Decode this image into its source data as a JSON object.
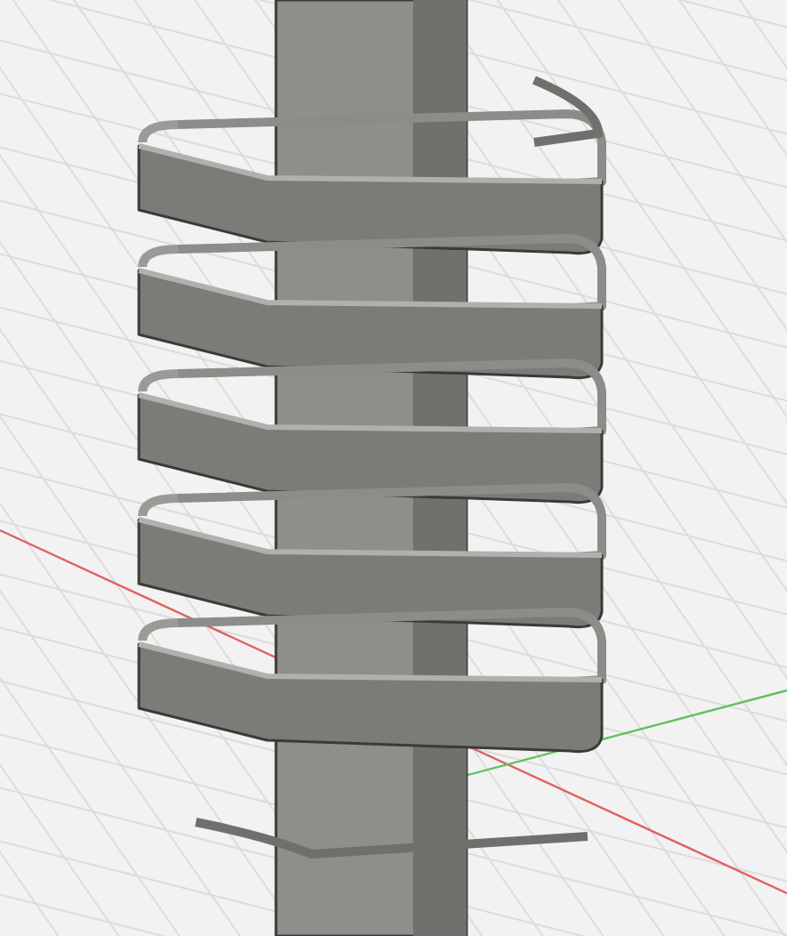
{
  "viewport": {
    "kind": "model"
  }
}
